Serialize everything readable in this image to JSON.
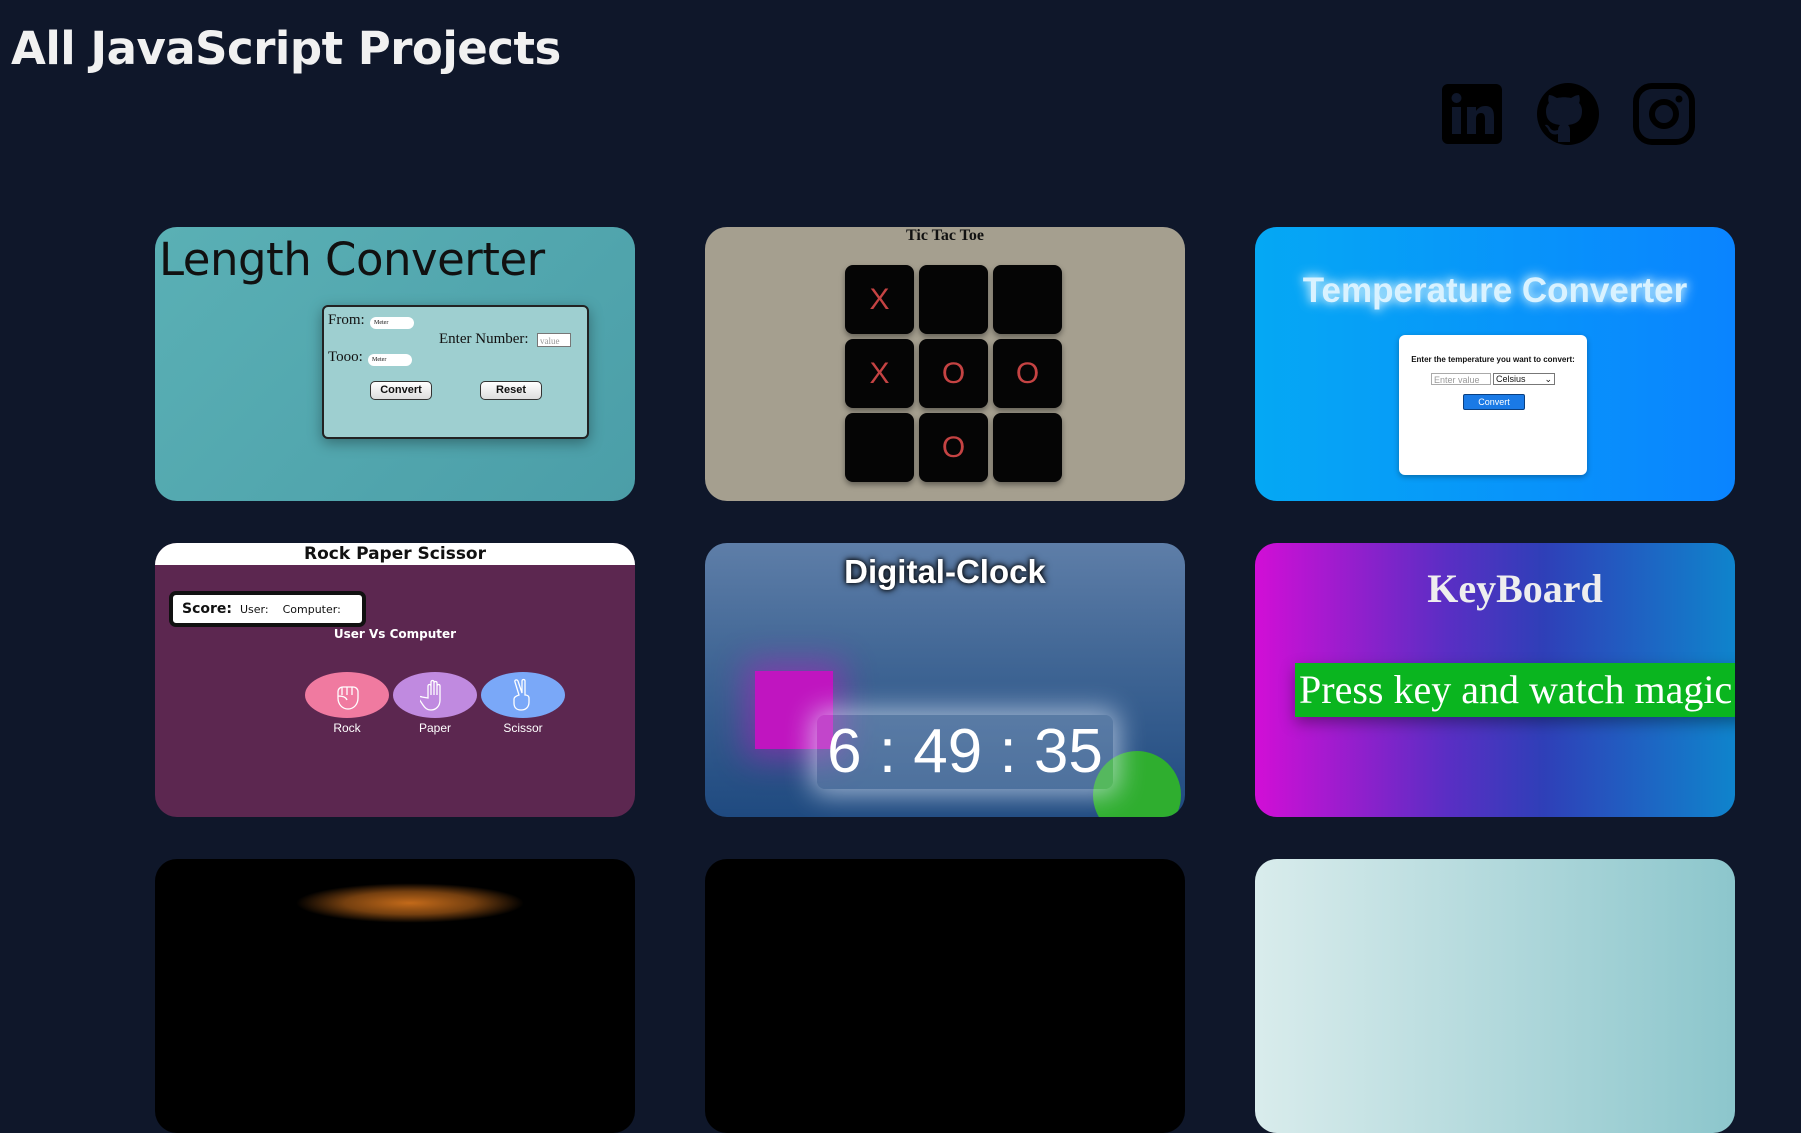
{
  "page": {
    "title": "All JavaScript Projects"
  },
  "social": [
    {
      "name": "linkedin"
    },
    {
      "name": "github"
    },
    {
      "name": "instagram"
    }
  ],
  "projects": {
    "length": {
      "title": "Length Converter",
      "from_label": "From:",
      "from_unit": "Meter",
      "to_label": "Tooo:",
      "to_unit": "Meter",
      "enter_label": "Enter Number:",
      "value_placeholder": "value",
      "convert": "Convert",
      "reset": "Reset"
    },
    "tictactoe": {
      "title": "Tic Tac Toe",
      "cells": [
        "X",
        "",
        "",
        "X",
        "O",
        "O",
        "",
        "O",
        ""
      ]
    },
    "temperature": {
      "title": "Temperature Converter",
      "prompt": "Enter the temperature you want to convert:",
      "input_placeholder": "Enter value",
      "unit": "Celsius",
      "convert": "Convert"
    },
    "rps": {
      "title": "Rock Paper Scissor",
      "score_label": "Score:",
      "user_label": "User:",
      "computer_label": "Computer:",
      "vs_label": "User Vs Computer",
      "choices": [
        {
          "label": "Rock",
          "color": "#f07aa0"
        },
        {
          "label": "Paper",
          "color": "#c08ae0"
        },
        {
          "label": "Scissor",
          "color": "#7aa8f8"
        }
      ]
    },
    "clock": {
      "title": "Digital-Clock",
      "time": "6 : 49 : 35"
    },
    "keyboard": {
      "title": "KeyBoard",
      "banner": "Press key and watch magic"
    }
  }
}
